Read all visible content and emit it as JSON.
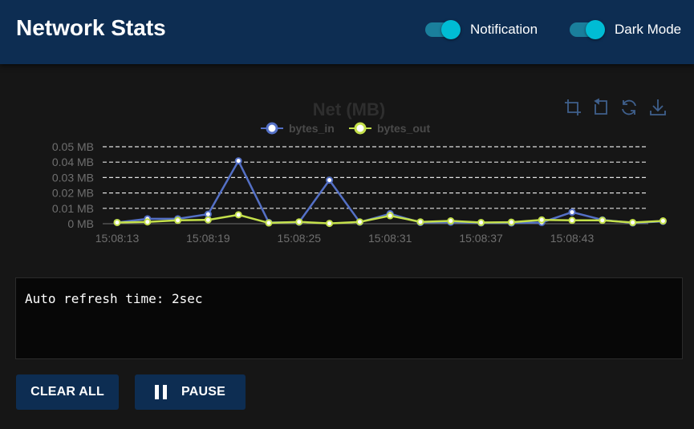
{
  "header": {
    "title": "Network Stats",
    "toggles": [
      {
        "label": "Notification",
        "on": true
      },
      {
        "label": "Dark Mode",
        "on": true
      }
    ]
  },
  "chart_data": {
    "type": "line",
    "title": "Net (MB)",
    "x_tick_labels": [
      "15:08:13",
      "15:08:19",
      "15:08:25",
      "15:08:31",
      "15:08:37",
      "15:08:43"
    ],
    "y_tick_labels": [
      "0 MB",
      "0.01 MB",
      "0.02 MB",
      "0.03 MB",
      "0.04 MB",
      "0.05 MB"
    ],
    "ylim": [
      0,
      0.05
    ],
    "grid": "horizontal dashed",
    "legend_position": "top-center",
    "series": [
      {
        "name": "bytes_in",
        "color": "#5470c6",
        "values": [
          0.0008,
          0.0032,
          0.0032,
          0.0062,
          0.0408,
          0.0008,
          0.001,
          0.0283,
          0.001,
          0.0065,
          0.0008,
          0.001,
          0.0005,
          0.0005,
          0.0008,
          0.0075,
          0.0025,
          0.0005,
          0.0015
        ]
      },
      {
        "name": "bytes_out",
        "color": "#c4e04a",
        "values": [
          0.0008,
          0.0012,
          0.0022,
          0.0025,
          0.0058,
          0.0005,
          0.0012,
          0.0002,
          0.0012,
          0.0052,
          0.0012,
          0.0018,
          0.0008,
          0.001,
          0.0025,
          0.0022,
          0.0022,
          0.0008,
          0.0018
        ]
      }
    ],
    "toolbox": [
      "zoom-icon",
      "zoom-reset-icon",
      "restore-icon",
      "download-icon"
    ]
  },
  "log": {
    "text": "Auto refresh time: 2sec"
  },
  "actions": {
    "clear_label": "CLEAR ALL",
    "pause_label": "PAUSE"
  }
}
